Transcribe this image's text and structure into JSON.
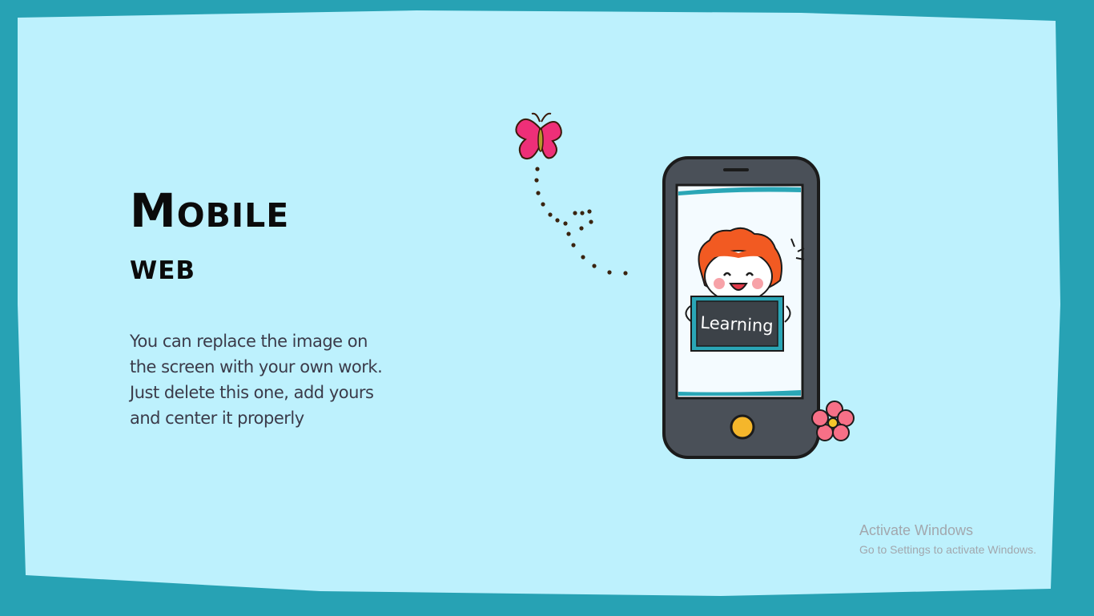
{
  "slide": {
    "title_line1": "Mobile",
    "title_line2": "web",
    "body": "You can replace the image on the screen with your own work. Just delete this one, add yours and center it properly",
    "screen_sign_text": "Learning"
  },
  "watermark": {
    "line1": "Activate Windows",
    "line2": "Go to Settings to activate Windows."
  },
  "colors": {
    "background": "#bdf1fd",
    "frame": "#27a2b4",
    "phone": "#4a5058",
    "accent_pink": "#ee2f78",
    "hair": "#f25a22",
    "home_button": "#f5b62b"
  }
}
